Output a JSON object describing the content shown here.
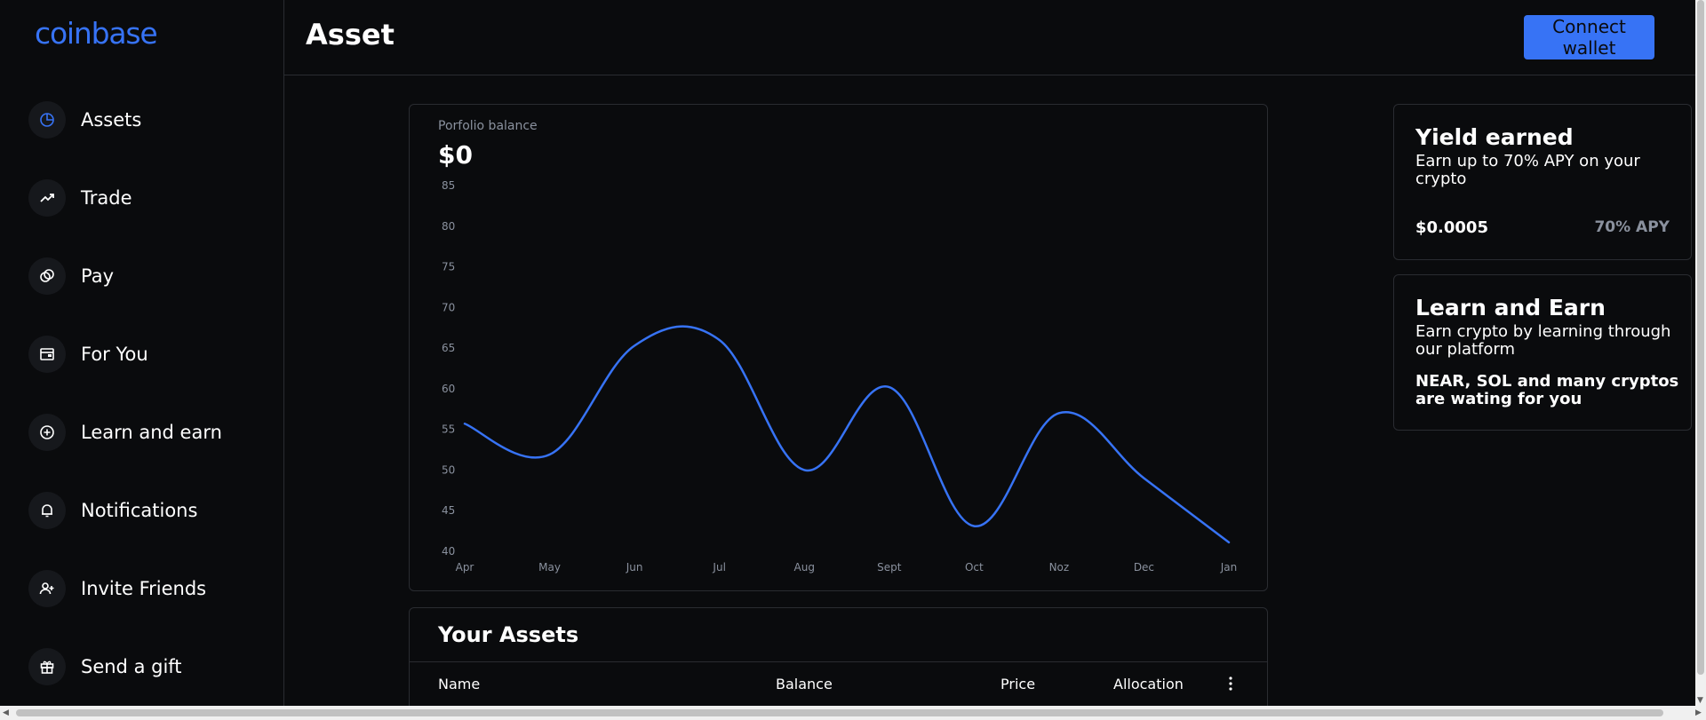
{
  "brand": {
    "logo_text": "coinbase",
    "accent": "#3773f5"
  },
  "sidebar": {
    "items": [
      {
        "label": "Assets",
        "icon": "pie-chart-icon"
      },
      {
        "label": "Trade",
        "icon": "trend-up-icon"
      },
      {
        "label": "Pay",
        "icon": "coins-icon"
      },
      {
        "label": "For You",
        "icon": "browser-icon"
      },
      {
        "label": "Learn and earn",
        "icon": "plus-circle-icon"
      },
      {
        "label": "Notifications",
        "icon": "bell-icon"
      },
      {
        "label": "Invite Friends",
        "icon": "user-plus-icon"
      },
      {
        "label": "Send a gift",
        "icon": "gift-icon"
      }
    ]
  },
  "header": {
    "title": "Asset",
    "connect_label": "Connect wallet"
  },
  "portfolio": {
    "label": "Porfolio balance",
    "value": "$0"
  },
  "chart_data": {
    "type": "line",
    "categories": [
      "Apr",
      "May",
      "Jun",
      "Jul",
      "Aug",
      "Sept",
      "Oct",
      "Noz",
      "Dec",
      "Jan"
    ],
    "values": [
      55.7,
      51.9,
      65.3,
      66,
      50,
      60.2,
      43.1,
      57,
      49,
      41.1
    ],
    "ylim": [
      40,
      85
    ],
    "yticks": [
      85,
      80,
      75,
      70,
      65,
      60,
      55,
      50,
      45,
      40
    ],
    "color": "#3773f5",
    "grid": false
  },
  "assets": {
    "title": "Your Assets",
    "columns": [
      "Name",
      "Balance",
      "Price",
      "Allocation"
    ]
  },
  "yield_card": {
    "title": "Yield earned",
    "text": "Earn up to 70% APY on your crypto",
    "amount": "$0.0005",
    "apy": "70% APY"
  },
  "learn_card": {
    "title": "Learn and Earn",
    "text": "Earn crypto by learning through our platform",
    "bold_text": "NEAR, SOL and many cryptos are wating for you"
  }
}
